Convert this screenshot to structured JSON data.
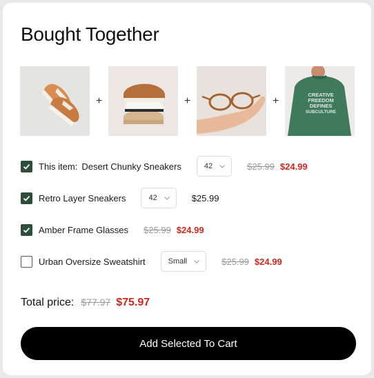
{
  "title": "Bought Together",
  "products": [
    {
      "image": "sneakers-photo",
      "name": "Desert Chunky Sneakers",
      "prefix": "This item:",
      "checked": true,
      "option": "42",
      "old_price": "$25.99",
      "price": "$24.99"
    },
    {
      "image": "layered-sneakers-photo",
      "name": "Retro Layer Sneakers",
      "checked": true,
      "option": "42",
      "price": "$25.99"
    },
    {
      "image": "glasses-photo",
      "name": "Amber Frame Glasses",
      "checked": true,
      "old_price": "$25.99",
      "price": "$24.99"
    },
    {
      "image": "sweatshirt-photo",
      "name": "Urban Oversize Sweatshirt",
      "checked": false,
      "option": "Small",
      "old_price": "$25.99",
      "price": "$24.99",
      "print": "CREATIVE FREEDOM DEFINES SUBCULTURE"
    }
  ],
  "plus": "+",
  "total": {
    "label": "Total price:",
    "old": "$77.97",
    "price": "$75.97"
  },
  "cart_button": "Add Selected To Cart",
  "colors": {
    "accent": "#2e4e3c",
    "sale": "#d0281f",
    "button": "#000000"
  }
}
